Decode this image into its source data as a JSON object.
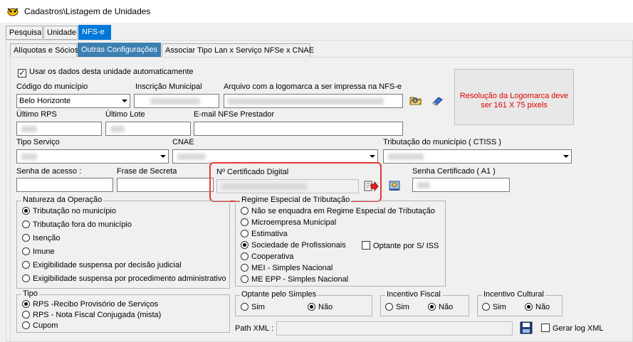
{
  "window": {
    "title": "Cadastros\\Listagem de Unidades"
  },
  "tabs_main": [
    "Pesquisa",
    "Unidade",
    "NFS-e"
  ],
  "tabs_sub": [
    "Alíquotas e Sócios",
    "Outras Configurações",
    "Associar Tipo Lan x Serviço NFSe x CNAE"
  ],
  "form": {
    "usar_dados_label": "Usar os dados desta unidade automaticamente",
    "usar_dados_checked": "✓",
    "codigo_municipio_label": "Código do município",
    "codigo_municipio_value": "Belo Horizonte",
    "inscricao_municipal_label": "Inscrição Municipal",
    "arquivo_logo_label": "Arquivo com a logomarca a ser impressa na NFS-e",
    "logo_resolution_text": "Resolução da Logomarca deve ser 161 X 75 pixels",
    "ultimo_rps_label": "Último RPS",
    "ultimo_lote_label": "Último Lote",
    "email_label": "E-mail NFSe Prestador",
    "tipo_servico_label": "Tipo Serviço",
    "cnae_label": "CNAE",
    "tributacao_label": "Tributação do município ( CTISS )",
    "senha_acesso_label": "Senha de acesso :",
    "frase_secreta_label": "Frase de Secreta",
    "certificado_label": "Nº Certificado Digital",
    "senha_certificado_label": "Senha Certificado ( A1 )"
  },
  "natureza": {
    "title": "Natureza da Operação",
    "options": [
      "Tributação no município",
      "Tributação fora do município",
      "Isenção",
      "Imune",
      "Exigibilidade suspensa por decisão judicial",
      "Exigibilidade suspensa por procedimento administrativo"
    ],
    "selected": 0
  },
  "regime": {
    "title": "Regime Especial de Tributação",
    "options": [
      "Não se enquadra em Regime Especial de Tributação",
      "Microempresa Municipal",
      "Estimativa",
      "Sociedade de Profissionais",
      "Cooperativa",
      "MEI - Simples Nacional",
      "ME EPP - Simples Nacional"
    ],
    "selected": 3,
    "optante_label": "Optante por S/ ISS"
  },
  "tipo": {
    "title": "Tipo",
    "options": [
      "RPS -Recibo Provisório de Serviços",
      "RPS - Nota Fiscal Conjugada (mista)",
      "Cupom"
    ],
    "selected": 0
  },
  "optante_simples": {
    "title": "Optante pelo Simples",
    "sim": "Sim",
    "nao": "Não"
  },
  "incentivo_fiscal": {
    "title": "Incentivo Fiscal",
    "sim": "Sim",
    "nao": "Não"
  },
  "incentivo_cultural": {
    "title": "Incentivo Cultural",
    "sim": "Sim",
    "nao": "Não"
  },
  "path_xml_label": "Path XML :",
  "gerar_log_label": "Gerar log XML",
  "colors": {
    "accent": "#0078d7",
    "highlight": "#e53935",
    "warning_text": "#e00000"
  }
}
